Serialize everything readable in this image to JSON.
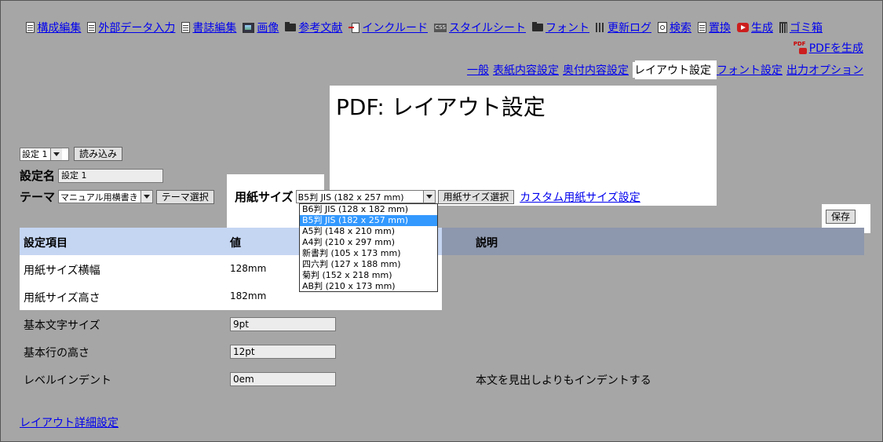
{
  "nav": {
    "items": [
      {
        "label": "構成編集",
        "icon": "document-list-icon"
      },
      {
        "label": "外部データ入力",
        "icon": "document-icon"
      },
      {
        "label": "書誌編集",
        "icon": "document-icon"
      },
      {
        "label": "画像",
        "icon": "image-icon"
      },
      {
        "label": "参考文献",
        "icon": "folder-icon"
      },
      {
        "label": "インクルード",
        "icon": "include-icon"
      },
      {
        "label": "スタイルシート",
        "icon": "css-icon"
      },
      {
        "label": "フォント",
        "icon": "folder-icon"
      },
      {
        "label": "更新ログ",
        "icon": "log-icon"
      },
      {
        "label": "検索",
        "icon": "search-icon"
      },
      {
        "label": "置換",
        "icon": "document-icon"
      },
      {
        "label": "生成",
        "icon": "play-icon"
      },
      {
        "label": "ゴミ箱",
        "icon": "trash-icon"
      }
    ],
    "pdf_generate": "PDFを生成"
  },
  "subtabs": [
    "一般",
    "表紙内容設定",
    "奥付内容設定",
    "レイアウト設定",
    "フォント設定",
    "出力オプション"
  ],
  "title": "PDF: レイアウト設定",
  "config": {
    "selected": "設定 1",
    "load_button": "読み込み",
    "name_label": "設定名",
    "name_value": "設定 1",
    "theme_label": "テーマ",
    "theme_value": "マニュアル用横書き",
    "theme_button": "テーマ選択"
  },
  "paper": {
    "label": "用紙サイズ",
    "selected": "B5判 JIS (182 x 257 mm)",
    "select_button": "用紙サイズ選択",
    "custom_link": "カスタム用紙サイズ設定",
    "options": [
      "B6判 JIS (128 x 182 mm)",
      "B5判 JIS (182 x 257 mm)",
      "A5判 (148 x 210 mm)",
      "A4判 (210 x 297 mm)",
      "新書判 (105 x 173 mm)",
      "四六判 (127 x 188 mm)",
      "菊判 (152 x 218 mm)",
      "AB判 (210 x 173 mm)"
    ],
    "highlighted_index": 1
  },
  "save_button": "保存",
  "table": {
    "headers": [
      "設定項目",
      "値",
      "説明"
    ],
    "rows": [
      {
        "label": "用紙サイズ横幅",
        "value": "128mm",
        "desc": ""
      },
      {
        "label": "用紙サイズ高さ",
        "value": "182mm",
        "desc": ""
      },
      {
        "label": "基本文字サイズ",
        "value": "9pt",
        "desc": ""
      },
      {
        "label": "基本行の高さ",
        "value": "12pt",
        "desc": ""
      },
      {
        "label": "レベルインデント",
        "value": "0em",
        "desc": "本文を見出しよりもインデントする"
      }
    ]
  },
  "detail_link": "レイアウト詳細設定",
  "colors": {
    "overlay": "#a6a6a6",
    "header_row": "#c5d6f3",
    "header_row_dim": "#8d97ad",
    "highlight": "#3399ff"
  }
}
